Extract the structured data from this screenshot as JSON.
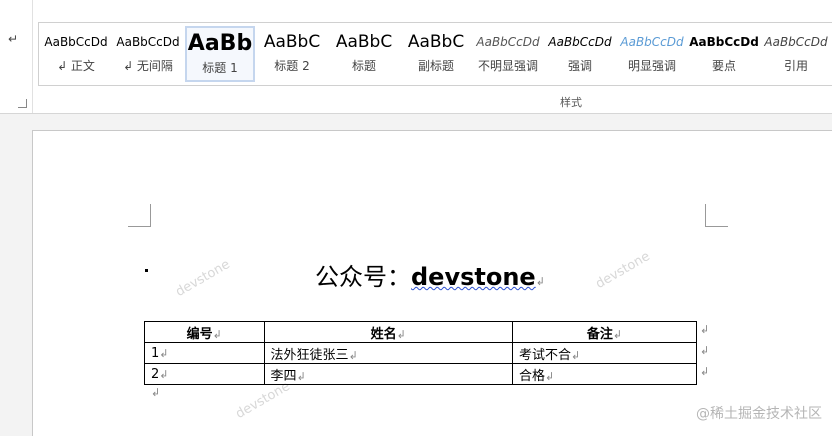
{
  "ribbon": {
    "group_label": "样式",
    "styles": [
      {
        "preview": "AaBbCcDd",
        "label": "↲ 正文"
      },
      {
        "preview": "AaBbCcDd",
        "label": "↲ 无间隔"
      },
      {
        "preview": "AaBb",
        "label": "标题 1"
      },
      {
        "preview": "AaBbC",
        "label": "标题 2"
      },
      {
        "preview": "AaBbC",
        "label": "标题"
      },
      {
        "preview": "AaBbC",
        "label": "副标题"
      },
      {
        "preview": "AaBbCcDd",
        "label": "不明显强调"
      },
      {
        "preview": "AaBbCcDd",
        "label": "强调"
      },
      {
        "preview": "AaBbCcDd",
        "label": "明显强调"
      },
      {
        "preview": "AaBbCcDd",
        "label": "要点"
      },
      {
        "preview": "AaBbCcDd",
        "label": "引用"
      }
    ],
    "selected_style": "标题 1",
    "accent_color": "#5b9bd5"
  },
  "document": {
    "title_cn": "公众号：",
    "title_en": "devstone",
    "para_mark": "↲",
    "table": {
      "headers": [
        "编号",
        "姓名",
        "备注"
      ],
      "rows": [
        [
          "1",
          "法外狂徒张三",
          "考试不合"
        ],
        [
          "2",
          "李四",
          "合格"
        ]
      ]
    },
    "watermark_text": "devstone"
  },
  "site_watermark": "@稀土掘金技术社区"
}
